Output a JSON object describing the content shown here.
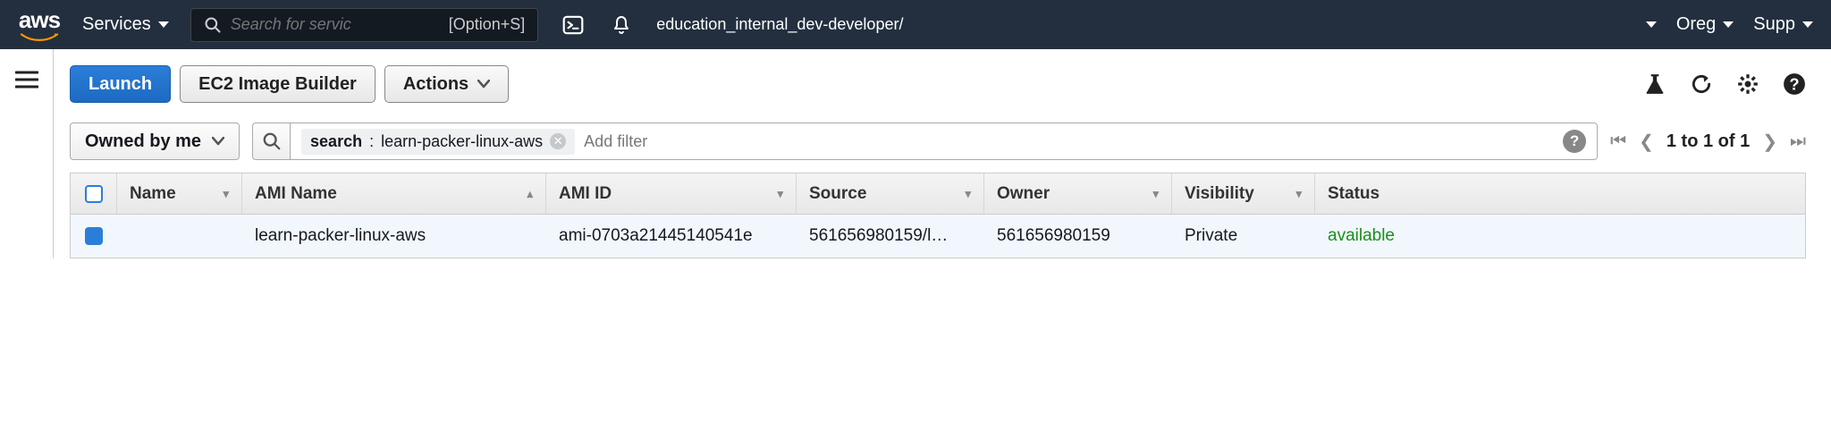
{
  "nav": {
    "services": "Services",
    "search_placeholder": "Search for servic",
    "search_kbd": "[Option+S]",
    "role": "education_internal_dev-developer/",
    "region": "Oreg",
    "support": "Supp"
  },
  "actions": {
    "launch": "Launch",
    "image_builder": "EC2 Image Builder",
    "actions": "Actions"
  },
  "filter": {
    "owned": "Owned by me",
    "chip_key": "search",
    "chip_val": "learn-packer-linux-aws",
    "add_filter": "Add filter"
  },
  "pager": {
    "text": "1 to 1 of 1"
  },
  "table": {
    "headers": {
      "name": "Name",
      "ami_name": "AMI Name",
      "ami_id": "AMI ID",
      "source": "Source",
      "owner": "Owner",
      "visibility": "Visibility",
      "status": "Status"
    },
    "rows": [
      {
        "name": "",
        "ami_name": "learn-packer-linux-aws",
        "ami_id": "ami-0703a21445140541e",
        "source": "561656980159/l…",
        "owner": "561656980159",
        "visibility": "Private",
        "status": "available"
      }
    ]
  }
}
